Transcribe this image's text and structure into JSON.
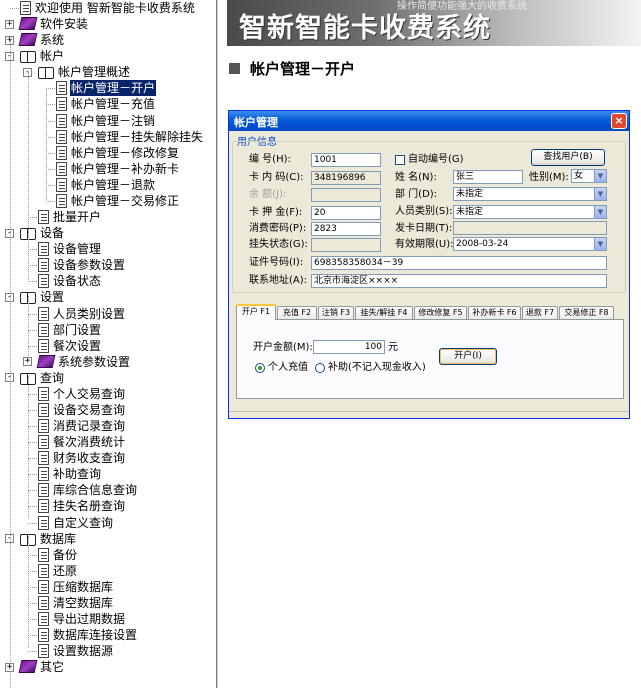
{
  "tree": [
    {
      "label": "欢迎使用 智新智能卡收费系统",
      "icon": "doc-icon",
      "box": ""
    },
    {
      "label": "软件安装",
      "icon": "book-closed-icon",
      "box": "+"
    },
    {
      "label": "系统",
      "icon": "book-closed-icon",
      "box": "+"
    },
    {
      "label": "帐户",
      "icon": "book-open-icon",
      "box": "-"
    },
    {
      "label": "帐户管理概述",
      "icon": "book-open-icon",
      "box": "-"
    },
    {
      "label": "帐户管理－开户",
      "icon": "doc-icon",
      "box": "",
      "selected": true
    },
    {
      "label": "帐户管理－充值",
      "icon": "doc-icon",
      "box": ""
    },
    {
      "label": "帐户管理－注销",
      "icon": "doc-icon",
      "box": ""
    },
    {
      "label": "帐户管理－挂失解除挂失",
      "icon": "doc-icon",
      "box": ""
    },
    {
      "label": "帐户管理－修改修复",
      "icon": "doc-icon",
      "box": ""
    },
    {
      "label": "帐户管理－补办新卡",
      "icon": "doc-icon",
      "box": ""
    },
    {
      "label": "帐户管理－退款",
      "icon": "doc-icon",
      "box": ""
    },
    {
      "label": "帐户管理－交易修正",
      "icon": "doc-icon",
      "box": ""
    },
    {
      "label": "批量开户",
      "icon": "doc-icon",
      "box": ""
    },
    {
      "label": "设备",
      "icon": "book-open-icon",
      "box": "-"
    },
    {
      "label": "设备管理",
      "icon": "doc-icon",
      "box": ""
    },
    {
      "label": "设备参数设置",
      "icon": "doc-icon",
      "box": ""
    },
    {
      "label": "设备状态",
      "icon": "doc-icon",
      "box": ""
    },
    {
      "label": "设置",
      "icon": "book-open-icon",
      "box": "-"
    },
    {
      "label": "人员类别设置",
      "icon": "doc-icon",
      "box": ""
    },
    {
      "label": "部门设置",
      "icon": "doc-icon",
      "box": ""
    },
    {
      "label": "餐次设置",
      "icon": "doc-icon",
      "box": ""
    },
    {
      "label": "系统参数设置",
      "icon": "book-closed-icon",
      "box": "+"
    },
    {
      "label": "查询",
      "icon": "book-open-icon",
      "box": "-"
    },
    {
      "label": "个人交易查询",
      "icon": "doc-icon",
      "box": ""
    },
    {
      "label": "设备交易查询",
      "icon": "doc-icon",
      "box": ""
    },
    {
      "label": "消费记录查询",
      "icon": "doc-icon",
      "box": ""
    },
    {
      "label": "餐次消费统计",
      "icon": "doc-icon",
      "box": ""
    },
    {
      "label": "财务收支查询",
      "icon": "doc-icon",
      "box": ""
    },
    {
      "label": "补助查询",
      "icon": "doc-icon",
      "box": ""
    },
    {
      "label": "库综合信息查询",
      "icon": "doc-icon",
      "box": ""
    },
    {
      "label": "挂失名册查询",
      "icon": "doc-icon",
      "box": ""
    },
    {
      "label": "自定义查询",
      "icon": "doc-icon",
      "box": ""
    },
    {
      "label": "数据库",
      "icon": "book-open-icon",
      "box": "-"
    },
    {
      "label": "备份",
      "icon": "doc-icon",
      "box": ""
    },
    {
      "label": "还原",
      "icon": "doc-icon",
      "box": ""
    },
    {
      "label": "压缩数据库",
      "icon": "doc-icon",
      "box": ""
    },
    {
      "label": "清空数据库",
      "icon": "doc-icon",
      "box": ""
    },
    {
      "label": "导出过期数据",
      "icon": "doc-icon",
      "box": ""
    },
    {
      "label": "数据库连接设置",
      "icon": "doc-icon",
      "box": ""
    },
    {
      "label": "设置数据源",
      "icon": "doc-icon",
      "box": ""
    },
    {
      "label": "其它",
      "icon": "book-closed-icon",
      "box": "+"
    }
  ],
  "banner": {
    "title": "智新智能卡收费系统",
    "tagline": "操作简便功能强大的收费系统"
  },
  "section_title": "帐户管理－开户",
  "dialog": {
    "title": "帐户管理",
    "close_glyph": "×",
    "group_title": "用户信息",
    "labels": {
      "number": "编    号(H):",
      "card_code": "卡 内 码(C):",
      "balance": "余    额(J):",
      "deposit": "卡 押 金(F):",
      "password": "消费密码(P):",
      "loss_status": "挂失状态(G):",
      "id_number": "证件号码(I):",
      "address": "联系地址(A):",
      "auto_number": "自动编号(G)",
      "name": "姓    名(N):",
      "gender": "性别(M):",
      "department": "部    门(D):",
      "person_type": "人员类别(S):",
      "issue_date": "发卡日期(T):",
      "valid_until": "有效期限(U):"
    },
    "values": {
      "number": "1001",
      "card_code": "348196896",
      "balance": "",
      "deposit": "20",
      "password": "2823",
      "loss_status": "",
      "id_number": "698358358034－39",
      "address": "北京市海淀区××××",
      "name": "张三",
      "gender": "女",
      "department": "未指定",
      "person_type": "未指定",
      "issue_date": "",
      "valid_until": "2008-03-24"
    },
    "find_user_button": "查找用户(B)",
    "tabs": [
      {
        "label": "开户 F1",
        "active": true
      },
      {
        "label": "充值 F2"
      },
      {
        "label": "注销 F3"
      },
      {
        "label": "挂失/解挂 F4"
      },
      {
        "label": "修改修复 F5"
      },
      {
        "label": "补办新卡 F6"
      },
      {
        "label": "退款 F7"
      },
      {
        "label": "交易修正 F8"
      }
    ],
    "panel": {
      "amount_label": "开户金额(M):",
      "amount_value": "100",
      "amount_unit": "元",
      "open_button": "开户(I)",
      "radio_personal": "个人充值",
      "radio_subsidy": "补助(不记入现金收入)"
    }
  }
}
